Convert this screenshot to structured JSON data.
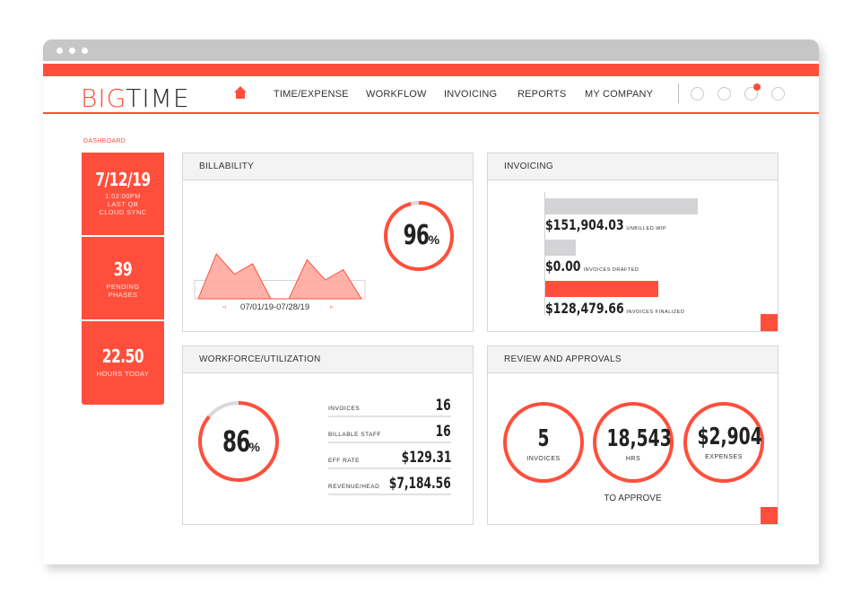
{
  "colors": {
    "accent": "#ff4f3c",
    "gray_bar": "#d4d4d6",
    "chart_fill": "#ffa89e"
  },
  "app": {
    "logo_part1": "BIG",
    "logo_part2": "TIME"
  },
  "nav": {
    "home_icon": "home-icon",
    "items": [
      "TIME/EXPENSE",
      "WORKFLOW",
      "INVOICING",
      "REPORTS",
      "MY COMPANY"
    ],
    "right_icons": [
      "circle-icon-1",
      "circle-icon-2",
      "notification-icon",
      "circle-icon-4"
    ]
  },
  "breadcrumb": "DASHBOARD",
  "tiles": [
    {
      "value": "7/12/19",
      "sub": [
        "1:02:00PM",
        "LAST QB",
        "CLOUD SYNC"
      ]
    },
    {
      "value": "39",
      "sub": [
        "PENDING",
        "PHASES"
      ]
    },
    {
      "value": "22.50",
      "sub": [
        "HOURS TODAY"
      ]
    }
  ],
  "billability": {
    "title": "BILLABILITY",
    "percent": 96,
    "percent_num": "96",
    "percent_sym": "%",
    "date_range": "07/01/19-07/28/19"
  },
  "invoicing": {
    "title": "INVOICING",
    "rows": [
      {
        "amount": "$151,904.03",
        "label": "UNBILLED WIP",
        "bar_fraction": 1.0,
        "color": "gray"
      },
      {
        "amount": "$0.00",
        "label": "INVOICES DRAFTED",
        "bar_fraction": 0.2,
        "color": "gray"
      },
      {
        "amount": "$128,479.66",
        "label": "INVOICES FINALIZED",
        "bar_fraction": 0.74,
        "color": "accent"
      }
    ]
  },
  "workforce": {
    "title": "WORKFORCE/UTILIZATION",
    "percent": 86,
    "percent_num": "86",
    "percent_sym": "%",
    "stats": [
      {
        "label": "INVOICES",
        "value": "16"
      },
      {
        "label": "BILLABLE STAFF",
        "value": "16"
      },
      {
        "label": "EFF RATE",
        "value": "$129.31"
      },
      {
        "label": "REVENUE/HEAD",
        "value": "$7,184.56"
      }
    ]
  },
  "approvals": {
    "title": "REVIEW AND APPROVALS",
    "items": [
      {
        "value": "5",
        "label": "INVOICES"
      },
      {
        "value": "18,543",
        "label": "HRS"
      },
      {
        "value": "$2,904",
        "label": "EXPENSES"
      }
    ],
    "footer": "TO APPROVE"
  },
  "chart_data": {
    "type": "area",
    "title": "BILLABILITY",
    "x_range_label": "07/01/19-07/28/19",
    "x": [
      0,
      1,
      2,
      3,
      4,
      5,
      6,
      7,
      8,
      9
    ],
    "values": [
      0,
      1.0,
      0.55,
      0.78,
      0,
      0,
      0.87,
      0.42,
      0.65,
      0
    ],
    "ylim": [
      0,
      1
    ],
    "threshold_band": [
      0,
      0.41
    ]
  }
}
